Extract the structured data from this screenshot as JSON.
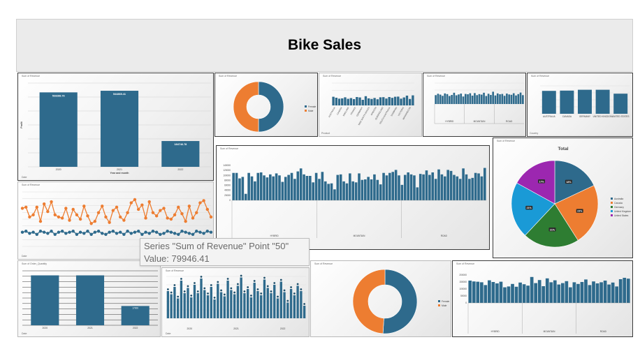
{
  "dashboard": {
    "title": "Bike Sales",
    "colors": {
      "primary": "#2e6a8c",
      "secondary": "#ed7d31",
      "grey": "#a5a5a5",
      "green": "#2e7d32",
      "teal": "#1a9ad6",
      "purple": "#9c27b0"
    }
  },
  "panel_labels": {
    "sum_revenue": "Sum of Revenue",
    "sum_quantity": "Sum of Order_Quantity",
    "date": "Date",
    "gender": "Gender",
    "country": "Country",
    "age_group": "Age_Group",
    "product": "Product"
  },
  "tooltip": {
    "line1": "Series \"Sum of Revenue\" Point \"50\"",
    "line2": "Value: 79946.41"
  },
  "chart_data": [
    {
      "id": "yearly-revenue",
      "type": "bar",
      "categories": [
        "2020",
        "2021",
        "2022"
      ],
      "values": [
        533288.76,
        544865.41,
        184746.78
      ],
      "value_labels": [
        "533288.76",
        "544865.41",
        "184746.78"
      ],
      "xlabel": "Year and month",
      "ylabel": "Profit",
      "ylim": [
        0,
        600000
      ]
    },
    {
      "id": "gender-donut",
      "type": "pie",
      "labels": [
        "Female",
        "Male"
      ],
      "values": [
        50,
        50
      ]
    },
    {
      "id": "product-bars-1",
      "type": "bar",
      "categories": [
        "AUSTRALIA",
        "CANADA",
        "ENGLAND",
        "FRANCE",
        "GERMANY",
        "NEW SOUTH WALES",
        "OREGON",
        "QUEENSLAND",
        "SOUTH AUSTRALIA",
        "TASMANIA",
        "VICTORIA",
        "WASHINGTON"
      ],
      "values": [
        62,
        55,
        48,
        50,
        58,
        47,
        52,
        45,
        60,
        57,
        40,
        66,
        50,
        46,
        53,
        44,
        58,
        59,
        49,
        60,
        54,
        62,
        63,
        48,
        57,
        70,
        46,
        72
      ]
    },
    {
      "id": "product-bars-2",
      "type": "bar",
      "categories": [
        "HYBRID",
        "MOUNTAIN",
        "ROAD"
      ],
      "values": [
        52,
        60,
        55,
        48,
        62,
        58,
        47,
        53,
        66,
        51,
        56,
        61,
        44,
        59,
        57,
        63,
        49,
        64,
        52,
        58,
        55,
        66,
        47,
        60,
        53,
        72,
        50,
        62,
        57,
        59,
        48,
        61,
        56,
        54,
        63,
        50,
        58,
        67,
        52
      ]
    },
    {
      "id": "country-bars",
      "type": "bar",
      "categories": [
        "AUSTRALIA",
        "CANADA",
        "GERMANY",
        "UNITED KINGDOM",
        "UNITED STATES"
      ],
      "values": [
        82,
        83,
        86,
        86,
        72
      ]
    },
    {
      "id": "revenue-by-state",
      "type": "bar",
      "categories": [
        "HYBRID",
        "MOUNTAIN",
        "ROAD"
      ],
      "ylabels": [
        "0",
        "20000",
        "40000",
        "60000",
        "80000",
        "100000",
        "120000",
        "140000"
      ],
      "values": [
        110000,
        110000,
        88000,
        94000,
        26000,
        110000,
        96000,
        76000,
        110000,
        112000,
        100000,
        92000,
        104000,
        96000,
        108000,
        100000,
        74000,
        94000,
        102000,
        110000,
        86000,
        116000,
        128000,
        104000,
        98000,
        98000,
        72000,
        110000,
        86000,
        114000,
        76000,
        66000,
        68000,
        44000,
        102000,
        104000,
        76000,
        68000,
        108000,
        76000,
        72000,
        108000,
        82000,
        84000,
        94000,
        84000,
        104000,
        82000,
        64000,
        110000,
        100000,
        110000,
        114000,
        122000,
        100000,
        62000,
        102000,
        112000,
        104000,
        100000,
        52000,
        106000,
        104000,
        120000,
        102000,
        112000,
        86000,
        124000,
        104000,
        96000,
        122000,
        118000,
        102000,
        96000,
        86000,
        128000,
        104000,
        86000,
        90000,
        110000,
        108000,
        96000,
        130000
      ]
    },
    {
      "id": "country-pie",
      "type": "pie",
      "title": "Total",
      "labels": [
        "Australia",
        "Canada",
        "Germany",
        "United Kingdom",
        "United States"
      ],
      "values": [
        18,
        23,
        21,
        21,
        17
      ],
      "value_labels": [
        "18%",
        "23%",
        "21%",
        "21%",
        "17%"
      ]
    },
    {
      "id": "daily-lines",
      "type": "line",
      "series": [
        {
          "name": "Sum of Revenue",
          "values": [
            70,
            72,
            54,
            58,
            72,
            46,
            78,
            64,
            82,
            58,
            54,
            52,
            70,
            48,
            68,
            58,
            50,
            74,
            56,
            42,
            46,
            62,
            74,
            54,
            44,
            66,
            72,
            54,
            48,
            62,
            80,
            86,
            68,
            76,
            52,
            82,
            62,
            56,
            66,
            70,
            52,
            50,
            58,
            72,
            60,
            46,
            74,
            52,
            62,
            80,
            84,
            68,
            54
          ]
        },
        {
          "name": "Sum of Order_Quantity",
          "values": [
            26,
            28,
            24,
            26,
            22,
            28,
            26,
            24,
            28,
            22,
            26,
            28,
            24,
            26,
            28,
            22,
            26,
            24,
            28,
            22,
            26,
            28,
            24,
            22,
            26,
            28,
            24,
            26,
            22,
            28,
            24,
            26,
            28,
            22,
            26,
            24,
            28,
            26,
            22,
            24,
            28,
            26,
            24,
            22,
            28,
            26,
            24,
            22,
            28,
            26,
            24,
            28,
            26
          ]
        }
      ]
    },
    {
      "id": "yearly-quantity",
      "type": "bar",
      "categories": [
        "2020",
        "2021",
        "2022"
      ],
      "values": [
        44000,
        44000,
        17000
      ],
      "value_labels": [
        "",
        "",
        "17000"
      ]
    },
    {
      "id": "month-bars",
      "type": "bar",
      "categories": [
        "2020",
        "2021",
        "2022"
      ],
      "values": [
        52,
        46,
        60,
        38,
        72,
        48,
        58,
        40,
        64,
        48,
        76,
        54,
        44,
        60,
        36,
        66,
        50,
        42,
        72,
        54,
        46,
        62,
        78,
        48,
        56,
        40,
        68,
        52,
        44,
        74,
        58,
        48,
        64,
        38,
        70,
        50,
        30,
        56,
        44,
        62,
        52,
        24
      ]
    },
    {
      "id": "gender-donut-2",
      "type": "pie",
      "labels": [
        "Female",
        "Male"
      ],
      "values": [
        51,
        49
      ],
      "value_labels": [
        "",
        ""
      ]
    },
    {
      "id": "revenue-bars-bottom",
      "type": "bar",
      "categories": [
        "HYBRID",
        "MOUNTAIN",
        "ROAD"
      ],
      "ylabels": [
        "0",
        "50000",
        "100000",
        "150000",
        "200000"
      ],
      "values": [
        160000,
        154000,
        152000,
        148000,
        128000,
        162000,
        150000,
        140000,
        152000,
        112000,
        118000,
        136000,
        116000,
        146000,
        134000,
        124000,
        186000,
        142000,
        164000,
        120000,
        176000,
        148000,
        162000,
        132000,
        142000,
        156000,
        112000,
        148000,
        136000,
        150000,
        168000,
        128000,
        154000,
        140000,
        148000,
        160000,
        132000,
        146000,
        118000,
        170000,
        180000,
        174000
      ]
    }
  ]
}
